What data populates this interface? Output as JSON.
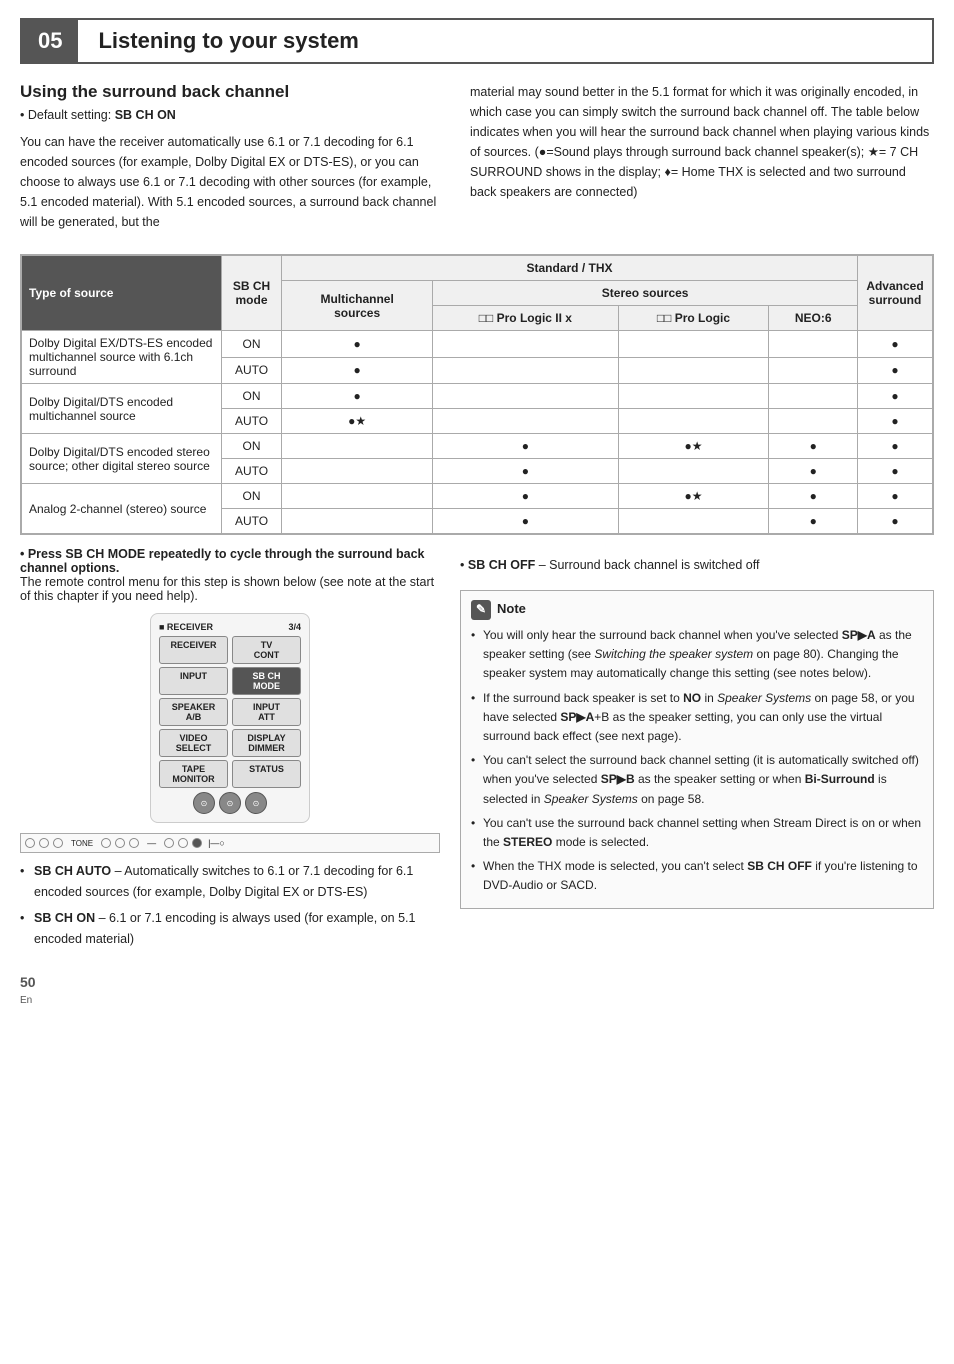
{
  "header": {
    "chapter_num": "05",
    "chapter_title": "Listening to your system"
  },
  "section": {
    "title": "Using the surround back channel",
    "default_setting": "Default setting: SB CH ON",
    "left_body": "You can have the receiver automatically use 6.1 or 7.1 decoding for 6.1 encoded sources (for example, Dolby Digital EX or DTS-ES), or you can choose to always use 6.1 or 7.1 decoding with other sources (for example, 5.1 encoded material). With 5.1 encoded sources, a surround back channel will be generated, but the",
    "right_body": "material may sound better in the 5.1 format for which it was originally encoded, in which case you can simply switch the surround back channel off. The table below indicates when you will hear the surround back channel when playing various kinds of sources. (●=Sound plays through surround back channel speaker(s); ★= 7 CH SURROUND shows in the display; ♦= Home THX is selected and two surround back speakers are connected)"
  },
  "table": {
    "col_source": "Type of source",
    "col_sbch": "SB CH mode",
    "col_standard_thx": "Standard / THX",
    "col_multichannel": "Multichannel sources",
    "col_stereo": "Stereo sources",
    "col_pro_logic_x": "DD Pro Logic II x",
    "col_pro_logic": "DD Pro Logic",
    "col_neo6": "NEO:6",
    "col_advanced": "Advanced surround",
    "rows": [
      {
        "source": "Dolby Digital EX/DTS-ES encoded multichannel source with 6.1ch surround",
        "modes": [
          {
            "mode": "ON",
            "multichannel": "●",
            "pro_logic_x": "",
            "pro_logic": "",
            "neo6": "",
            "advanced": "●"
          },
          {
            "mode": "AUTO",
            "multichannel": "●",
            "pro_logic_x": "",
            "pro_logic": "",
            "neo6": "",
            "advanced": "●"
          }
        ]
      },
      {
        "source": "Dolby Digital/DTS encoded multichannel source",
        "modes": [
          {
            "mode": "ON",
            "multichannel": "●",
            "pro_logic_x": "",
            "pro_logic": "",
            "neo6": "",
            "advanced": "●"
          },
          {
            "mode": "AUTO",
            "multichannel": "●★",
            "pro_logic_x": "",
            "pro_logic": "",
            "neo6": "",
            "advanced": "●"
          }
        ]
      },
      {
        "source": "Dolby Digital/DTS encoded stereo source; other digital stereo source",
        "modes": [
          {
            "mode": "ON",
            "multichannel": "",
            "pro_logic_x": "●",
            "pro_logic": "●★",
            "neo6": "●",
            "advanced": "●"
          },
          {
            "mode": "AUTO",
            "multichannel": "",
            "pro_logic_x": "●",
            "pro_logic": "",
            "neo6": "●",
            "advanced": "●"
          }
        ]
      },
      {
        "source": "Analog 2-channel (stereo) source",
        "modes": [
          {
            "mode": "ON",
            "multichannel": "",
            "pro_logic_x": "●",
            "pro_logic": "●★",
            "neo6": "●",
            "advanced": "●"
          },
          {
            "mode": "AUTO",
            "multichannel": "",
            "pro_logic_x": "●",
            "pro_logic": "",
            "neo6": "●",
            "advanced": "●"
          }
        ]
      }
    ]
  },
  "bottom": {
    "press_note_bold": "Press SB CH MODE repeatedly to cycle through the surround back channel options.",
    "press_note_body": "The remote control menu for this step is shown below (see note at the start of this chapter if you need help).",
    "remote": {
      "header_left": "RECEIVER",
      "header_right": "3/4",
      "btn_receiver": "RECEIVER",
      "btn_tv_cont": "TV CONT",
      "btn_input": "INPUT",
      "btn_sbch_mode": "SB CH MODE",
      "btn_speaker_ab": "SPEAKER A/B",
      "btn_input_att": "INPUT ATT",
      "btn_video_select": "VIDEO SELECT",
      "btn_display_dimmer": "DISPLAY DIMMER",
      "btn_tape_monitor": "TAPE MONITOR",
      "btn_status": "STATUS"
    },
    "options": [
      {
        "label": "SB CH AUTO",
        "desc": "– Automatically switches to 6.1 or 7.1 decoding for 6.1 encoded sources (for example, Dolby Digital EX or DTS-ES)"
      },
      {
        "label": "SB CH ON",
        "desc": "– 6.1 or 7.1 encoding is always used (for example, on 5.1 encoded material)"
      }
    ],
    "sbch_off": "SB CH OFF",
    "sbch_off_desc": "– Surround back channel is switched off"
  },
  "note": {
    "title": "Note",
    "items": [
      "You will only hear the surround back channel when you've selected SP▶A as the speaker setting (see Switching the speaker system on page 80). Changing the speaker system may automatically change this setting (see notes below).",
      "If the surround back speaker is set to NO in Speaker Systems on page 58, or you have selected SP▶A+B as the speaker setting, you can only use the virtual surround back effect (see next page).",
      "You can't select the surround back channel setting (it is automatically switched off) when you've selected SP▶B as the speaker setting or when Bi-Surround is selected in Speaker Systems on page 58.",
      "You can't use the surround back channel setting when Stream Direct is on or when the STEREO mode is selected.",
      "When the THX mode is selected, you can't select SB CH OFF if you're listening to DVD-Audio or SACD."
    ]
  },
  "footer": {
    "page_num": "50",
    "lang": "En"
  }
}
